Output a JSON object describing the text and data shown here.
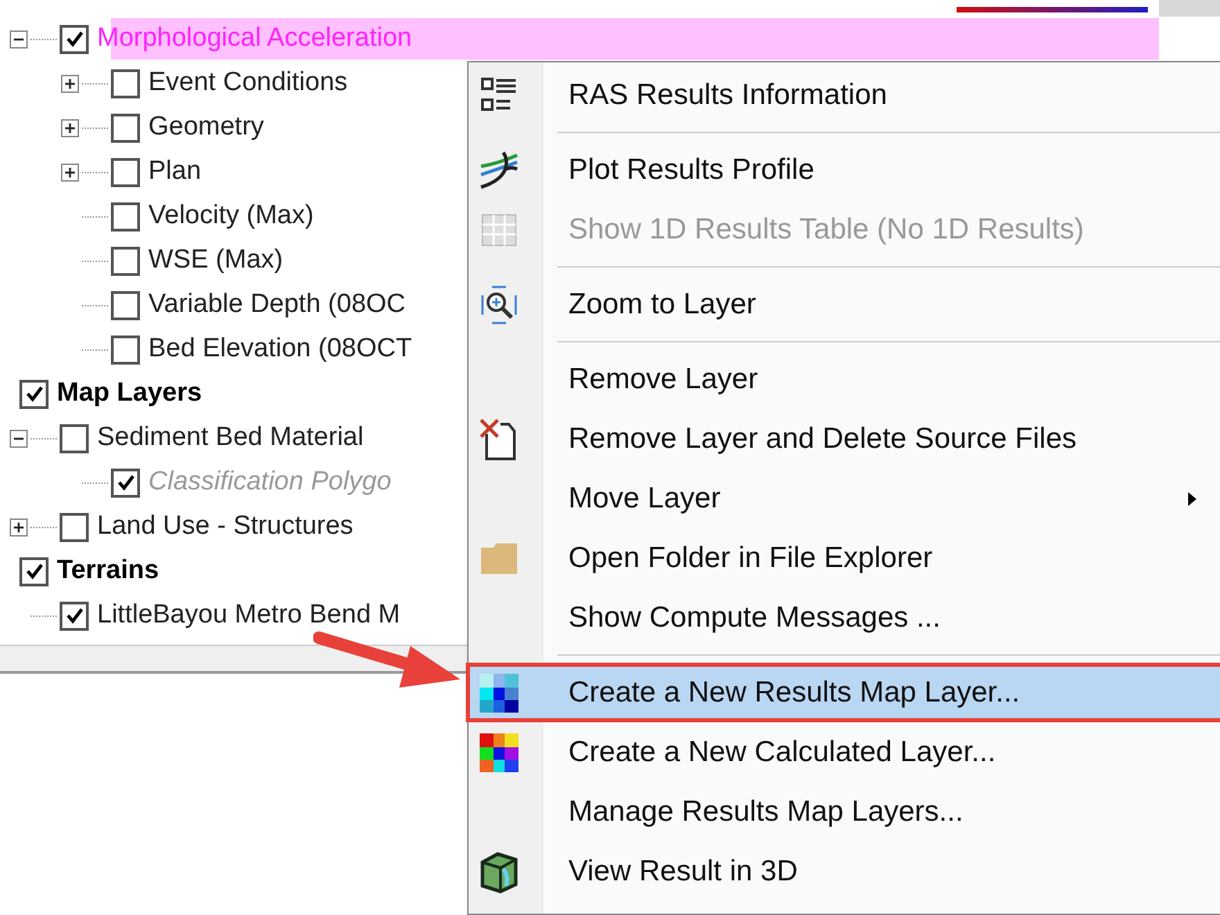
{
  "tree": [
    {
      "label": "Morphological Acceleration",
      "checked": true,
      "expanded": true,
      "selected": true,
      "bold": false,
      "children": [
        {
          "label": "Event Conditions",
          "checked": false,
          "expanded": false,
          "selected": false,
          "bold": false
        },
        {
          "label": "Geometry",
          "checked": false,
          "expanded": false,
          "selected": false,
          "bold": false
        },
        {
          "label": "Plan",
          "checked": false,
          "expanded": false,
          "selected": false,
          "bold": false
        },
        {
          "label": "Velocity (Max)",
          "checked": false,
          "selected": false,
          "bold": false
        },
        {
          "label": "WSE (Max)",
          "checked": false,
          "selected": false,
          "bold": false
        },
        {
          "label": "Variable Depth (08OC",
          "checked": false,
          "selected": false,
          "bold": false
        },
        {
          "label": "Bed Elevation (08OCT",
          "checked": false,
          "selected": false,
          "bold": false
        }
      ]
    },
    {
      "label": "Map Layers",
      "checked": true,
      "selected": false,
      "bold": true,
      "children": [
        {
          "label": "Sediment Bed Material",
          "checked": false,
          "expanded": true,
          "selected": false,
          "bold": false,
          "children": [
            {
              "label": "Classification Polygo",
              "checked": true,
              "selected": false,
              "bold": false,
              "dimmed": true
            }
          ]
        },
        {
          "label": "Land Use - Structures",
          "checked": false,
          "expanded": false,
          "selected": false,
          "bold": false
        }
      ]
    },
    {
      "label": "Terrains",
      "checked": true,
      "selected": false,
      "bold": true,
      "children": [
        {
          "label": "LittleBayou Metro Bend M",
          "checked": true,
          "selected": false,
          "bold": false
        }
      ]
    }
  ],
  "menu": [
    {
      "kind": "item",
      "label": "RAS Results Information",
      "disabled": false,
      "selected": false,
      "submenu": false
    },
    {
      "kind": "separator"
    },
    {
      "kind": "item",
      "label": "Plot Results Profile",
      "disabled": false,
      "selected": false,
      "submenu": false
    },
    {
      "kind": "item",
      "label": "Show 1D Results Table (No 1D Results)",
      "disabled": true,
      "selected": false,
      "submenu": false
    },
    {
      "kind": "separator"
    },
    {
      "kind": "item",
      "label": "Zoom to Layer",
      "disabled": false,
      "selected": false,
      "submenu": false
    },
    {
      "kind": "separator"
    },
    {
      "kind": "item",
      "label": "Remove Layer",
      "disabled": false,
      "selected": false,
      "submenu": false
    },
    {
      "kind": "item",
      "label": "Remove Layer and Delete Source Files",
      "disabled": false,
      "selected": false,
      "submenu": false
    },
    {
      "kind": "item",
      "label": "Move Layer",
      "disabled": false,
      "selected": false,
      "submenu": true
    },
    {
      "kind": "item",
      "label": "Open Folder in File Explorer",
      "disabled": false,
      "selected": false,
      "submenu": false
    },
    {
      "kind": "item",
      "label": "Show Compute Messages ...",
      "disabled": false,
      "selected": false,
      "submenu": false
    },
    {
      "kind": "separator"
    },
    {
      "kind": "item",
      "label": "Create a New Results Map Layer...",
      "disabled": false,
      "selected": true,
      "submenu": false,
      "annotated": true
    },
    {
      "kind": "item",
      "label": "Create a New Calculated Layer...",
      "disabled": false,
      "selected": false,
      "submenu": false
    },
    {
      "kind": "item",
      "label": "Manage Results Map Layers...",
      "disabled": false,
      "selected": false,
      "submenu": false
    },
    {
      "kind": "item",
      "label": "View Result in 3D",
      "disabled": false,
      "selected": false,
      "submenu": false
    }
  ]
}
